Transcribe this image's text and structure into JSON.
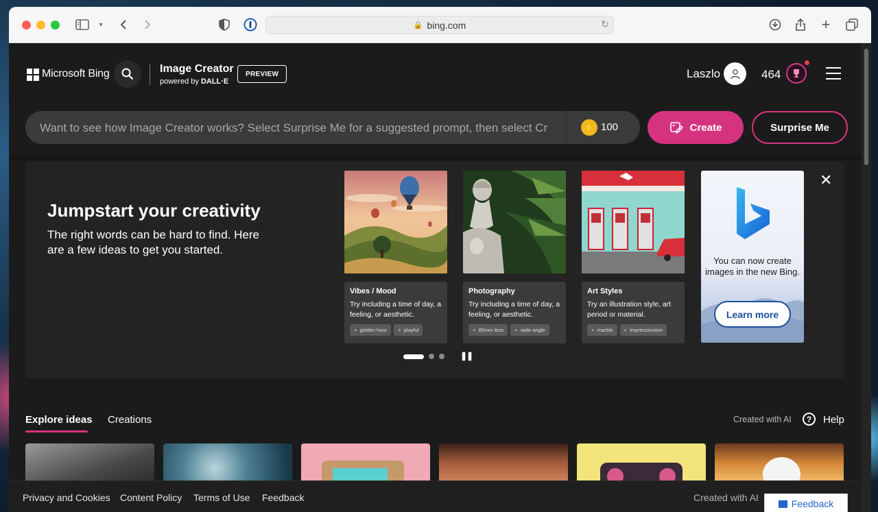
{
  "browser": {
    "url": "bing.com"
  },
  "header": {
    "brand": "Microsoft Bing",
    "title": "Image Creator",
    "powered_prefix": "powered by ",
    "powered_brand": "DALL·E",
    "badge": "PREVIEW",
    "username": "Laszlo",
    "points": "464"
  },
  "prompt": {
    "placeholder": "Want to see how Image Creator works? Select Surprise Me for a suggested prompt, then select Create",
    "boosts": "100",
    "create_label": "Create",
    "surprise_label": "Surprise Me"
  },
  "jumpstart": {
    "heading": "Jumpstart your creativity",
    "text": "The right words can be hard to find. Here are a few ideas to get you started.",
    "cards": [
      {
        "title": "Vibes / Mood",
        "desc": "Try including a time of day, a feeling, or aesthetic.",
        "tags": [
          "golden hour",
          "playful"
        ]
      },
      {
        "title": "Photography",
        "desc": "Try including a time of day, a feeling, or aesthetic.",
        "tags": [
          "85mm lens",
          "wide angle"
        ]
      },
      {
        "title": "Art Styles",
        "desc": "Try an illustration style, art period or material.",
        "tags": [
          "marble",
          "impressionism"
        ]
      }
    ],
    "promo_text": "You can now create images in the new Bing.",
    "promo_button": "Learn more",
    "carousel": {
      "slides": 3,
      "active": 1
    }
  },
  "tabs": {
    "explore": "Explore ideas",
    "creations": "Creations",
    "created_with_ai": "Created with AI",
    "help": "Help"
  },
  "footer": {
    "privacy": "Privacy and Cookies",
    "content_policy": "Content Policy",
    "terms": "Terms of Use",
    "feedback": "Feedback",
    "created_with_ai": "Created with AI",
    "feedback_button": "Feedback"
  },
  "colors": {
    "accent": "#d6337f",
    "page_bg": "#1b1b1b",
    "panel_bg": "#232323"
  }
}
